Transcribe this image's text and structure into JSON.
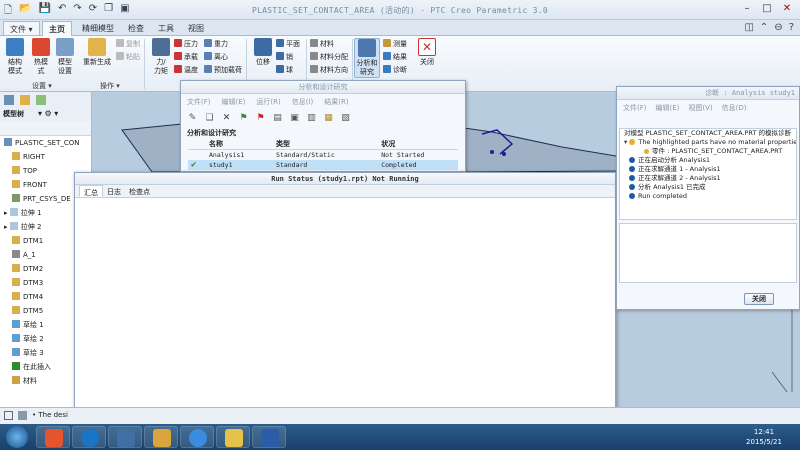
{
  "window": {
    "title": "PLASTIC_SET_CONTACT_AREA (活动的) - PTC Creo Parametric 3.0"
  },
  "ribbon": {
    "file_tab": "文件",
    "tabs": [
      "主页",
      "精细模型",
      "检查",
      "工具",
      "视图"
    ],
    "active_tab": "主页",
    "groups": {
      "setup_label": "设置",
      "operations_label": "操作"
    },
    "buttons": {
      "structure_mode": "结构\n模式",
      "thermal_mode": "热模\n式",
      "model_setup": "模型\n设置",
      "copy": "复制",
      "paste": "粘贴",
      "regenerate": "重新生成",
      "force_moment": "力/\n力矩",
      "pressure": "压力",
      "bearing": "承载",
      "temperature": "温度",
      "gravity": "重力",
      "centrifugal": "离心",
      "preload": "预加载荷",
      "displacement": "位移",
      "plane": "平面",
      "pin": "销",
      "ball": "球",
      "material": "材料",
      "material_assign": "材料分配",
      "material_orient": "材料方向",
      "analysis_study": "分析和\n研究",
      "measure": "测量",
      "results": "结果",
      "diagnostics": "诊断",
      "close": "关闭"
    }
  },
  "tree": {
    "toolbar_label": "模型树",
    "items": [
      {
        "label": "PLASTIC_SET_CON",
        "type": "part"
      },
      {
        "label": "RIGHT",
        "type": "plane"
      },
      {
        "label": "TOP",
        "type": "plane"
      },
      {
        "label": "FRONT",
        "type": "plane"
      },
      {
        "label": "PRT_CSYS_DE",
        "type": "csys"
      },
      {
        "label": "拉伸 1",
        "type": "feature"
      },
      {
        "label": "拉伸 2",
        "type": "feature"
      },
      {
        "label": "DTM1",
        "type": "plane"
      },
      {
        "label": "A_1",
        "type": "axis"
      },
      {
        "label": "DTM2",
        "type": "plane"
      },
      {
        "label": "DTM3",
        "type": "plane"
      },
      {
        "label": "DTM4",
        "type": "plane"
      },
      {
        "label": "DTM5",
        "type": "plane"
      },
      {
        "label": "草绘 1",
        "type": "sketch"
      },
      {
        "label": "草绘 2",
        "type": "sketch"
      },
      {
        "label": "草绘 3",
        "type": "sketch"
      },
      {
        "label": "在此插入",
        "type": "insert"
      },
      {
        "label": "材料",
        "type": "folder"
      }
    ]
  },
  "analysis_dialog": {
    "title": "分析和设计研究",
    "menu": [
      "文件(F)",
      "编辑(E)",
      "运行(R)",
      "信息(I)",
      "结果(R)"
    ],
    "group_label": "分析和设计研究",
    "columns": [
      "名称",
      "类型",
      "状况"
    ],
    "rows": [
      {
        "name": "Analysis1",
        "type": "Standard/Static",
        "status": "Not Started",
        "selected": false
      },
      {
        "name": "study1",
        "type": "Standard",
        "status": "Completed",
        "selected": true
      }
    ]
  },
  "run_dialog": {
    "title": "Run Status (study1.rpt) Not Running",
    "tabs": [
      "汇总",
      "日志",
      "检查点"
    ],
    "active_tab": "汇总"
  },
  "diag_dialog": {
    "title": "诊断 : Analysis study1",
    "menu": [
      "文件(F)",
      "编辑(E)",
      "视图(V)",
      "信息(D)"
    ],
    "lines": [
      {
        "text": "对模型 PLASTIC_SET_CONTACT_AREA.PRT 的模拟诊断",
        "kind": "header"
      },
      {
        "text": "The highlighted parts have no material properties",
        "kind": "warn"
      },
      {
        "text": "零件 : PLASTIC_SET_CONTACT_AREA.PRT",
        "kind": "sub"
      },
      {
        "text": "正在启动分析 Analysis1",
        "kind": "info"
      },
      {
        "text": "正在求解通道 1 - Analysis1",
        "kind": "info"
      },
      {
        "text": "正在求解通道 2 - Analysis1",
        "kind": "info"
      },
      {
        "text": "分析 Analysis1 已完成",
        "kind": "info"
      },
      {
        "text": "Run completed",
        "kind": "info"
      }
    ],
    "close_label": "关闭"
  },
  "statusbar": {
    "message": "The desi"
  },
  "taskbar": {
    "time": "12:41",
    "date": "2015/5/21"
  },
  "colors": {
    "accent": "#1d5aa8",
    "selection": "#bfe0f7",
    "graphics_bg": "#b8ccdf"
  }
}
